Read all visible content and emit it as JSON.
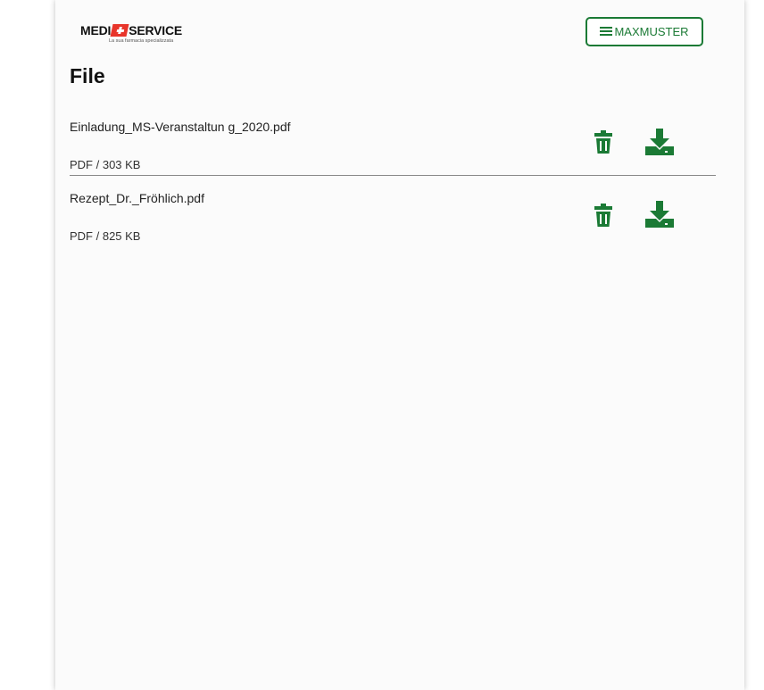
{
  "brand": {
    "name_left": "MEDI",
    "name_right": "SERVICE",
    "tagline": "La sua farmacia specializzata"
  },
  "header": {
    "menu_label": "MAXMUSTER"
  },
  "page": {
    "title": "File"
  },
  "files": [
    {
      "name": "Einladung_MS-Veranstaltun g_2020.pdf",
      "meta": "PDF / 303 KB"
    },
    {
      "name": "Rezept_Dr._Fröhlich.pdf",
      "meta": "PDF / 825 KB"
    }
  ],
  "icons": {
    "menu": "hamburger-icon",
    "delete": "trash-icon",
    "download": "download-icon"
  },
  "colors": {
    "accent": "#1b7a35",
    "logo_red": "#e8352b"
  }
}
